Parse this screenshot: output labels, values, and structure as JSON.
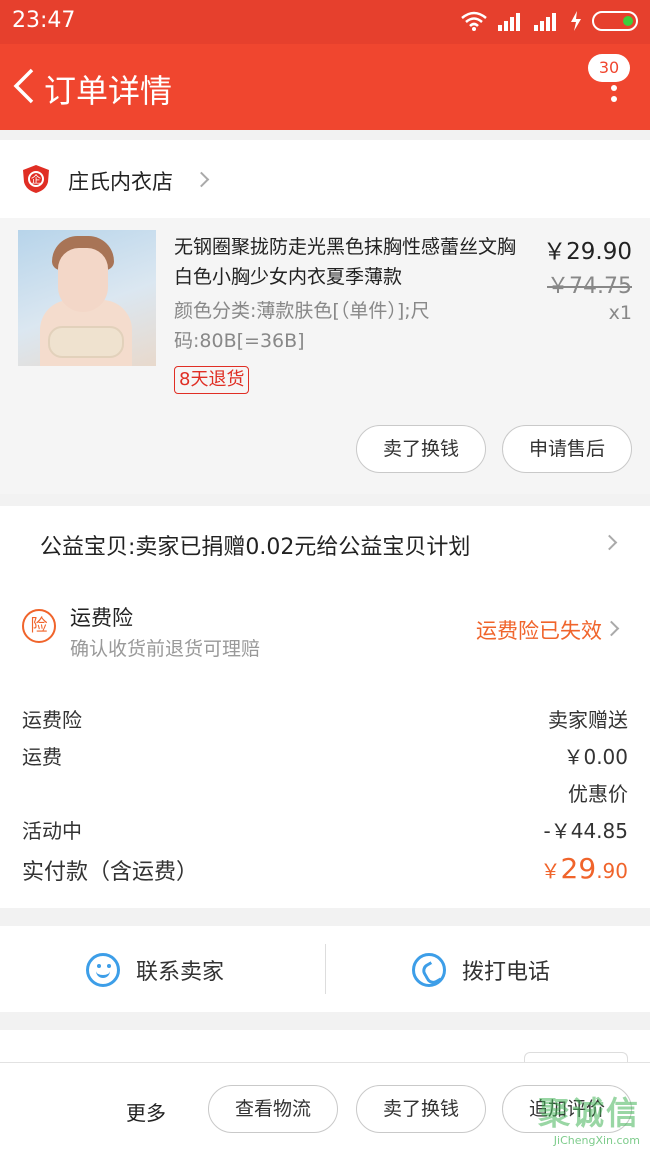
{
  "status_bar": {
    "time": "23:47"
  },
  "header": {
    "title": "订单详情",
    "badge": "30"
  },
  "shop": {
    "name": "庄氏内衣店",
    "logo_text": "企"
  },
  "item": {
    "title": "无钢圈聚拢防走光黑色抹胸性感蕾丝文胸白色小胸少女内衣夏季薄款",
    "spec": "颜色分类:薄款肤色[（单件）];尺码:80B[=36B]",
    "tag": "8天退货",
    "price": "￥29.90",
    "original_price": "￥74.75",
    "quantity": "x1",
    "btn_sell": "卖了换钱",
    "btn_after_sale": "申请售后"
  },
  "charity": {
    "text": "公益宝贝:卖家已捐赠0.02元给公益宝贝计划"
  },
  "insurance": {
    "icon_text": "险",
    "title": "运费险",
    "subtitle": "确认收货前退货可理赔",
    "status": "运费险已失效"
  },
  "fees": {
    "insurance_label": "运费险",
    "insurance_value": "卖家赠送",
    "shipping_label": "运费",
    "shipping_value": "￥0.00",
    "discount_note": "优惠价",
    "promo_label": "活动中",
    "promo_value": "-￥44.85",
    "total_label": "实付款（含运费）",
    "total_currency": "￥",
    "total_int": "29",
    "total_dec": ".90"
  },
  "contact": {
    "seller": "联系卖家",
    "call": "拨打电话"
  },
  "bottom_bar": {
    "more": "更多",
    "logistics": "查看物流",
    "sell": "卖了换钱",
    "review": "追加评价"
  },
  "watermark": {
    "main": "聚诚信",
    "sub": "JiChengXin.com"
  },
  "colors": {
    "brand": "#f0462f",
    "accent": "#f0642b",
    "link": "#3d9ee8"
  }
}
